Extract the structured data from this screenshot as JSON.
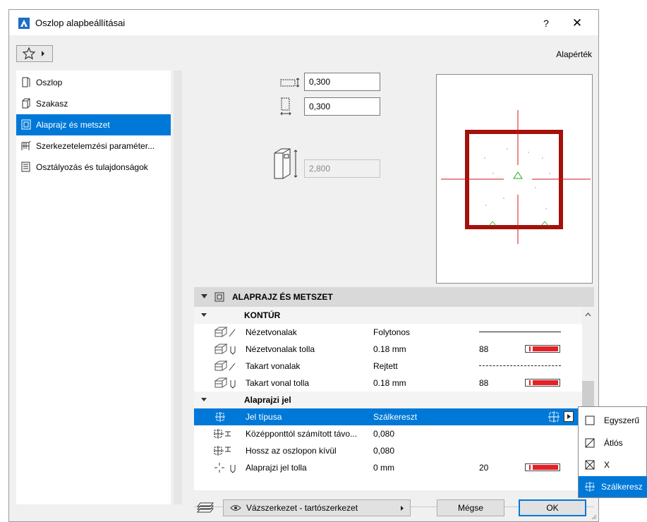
{
  "window": {
    "title": "Oszlop alapbeállításai",
    "help": "?",
    "close": "✕"
  },
  "toolbar": {
    "defaults_label": "Alapérték"
  },
  "sidebar": {
    "items": [
      {
        "label": "Oszlop",
        "icon": "column-icon"
      },
      {
        "label": "Szakasz",
        "icon": "segment-icon"
      },
      {
        "label": "Alaprajz és metszet",
        "icon": "floor-plan-icon",
        "selected": true
      },
      {
        "label": "Szerkezetelemzési paraméter...",
        "icon": "structural-analysis-icon"
      },
      {
        "label": "Osztályozás és tulajdonságok",
        "icon": "classification-icon"
      }
    ]
  },
  "dimensions": {
    "width": "0,300",
    "depth": "0,300",
    "height": "2,800"
  },
  "section": {
    "title": "ALAPRAJZ ÉS METSZET"
  },
  "table": {
    "group1": "KONTÚR",
    "rows1": [
      {
        "name": "Nézetvonalak",
        "value": "Folytonos"
      },
      {
        "name": "Nézetvonalak tolla",
        "value": "0.18 mm",
        "pen": "88"
      },
      {
        "name": "Takart vonalak",
        "value": "Rejtett"
      },
      {
        "name": "Takart vonal tolla",
        "value": "0.18 mm",
        "pen": "88"
      }
    ],
    "group2": "Alaprajzi jel",
    "rows2": [
      {
        "name": "Jel típusa",
        "value": "Szálkereszt"
      },
      {
        "name": "Középponttól számított távo...",
        "value": "0,080"
      },
      {
        "name": "Hossz az oszlopon kívül",
        "value": "0,080"
      },
      {
        "name": "Alaprajzi jel tolla",
        "value": "0 mm",
        "pen": "20"
      }
    ]
  },
  "footer": {
    "layer": "Vázszerkezet - tartószerkezet",
    "cancel": "Mégse",
    "ok": "OK"
  },
  "popup": {
    "items": [
      {
        "label": "Egyszerű"
      },
      {
        "label": "Átlós"
      },
      {
        "label": "X"
      },
      {
        "label": "Szálkeresz"
      }
    ]
  },
  "colors": {
    "accent": "#0078d7",
    "column_outline": "#a4110b",
    "crosshair": "#d4141c",
    "pen_red": "#e52026"
  }
}
